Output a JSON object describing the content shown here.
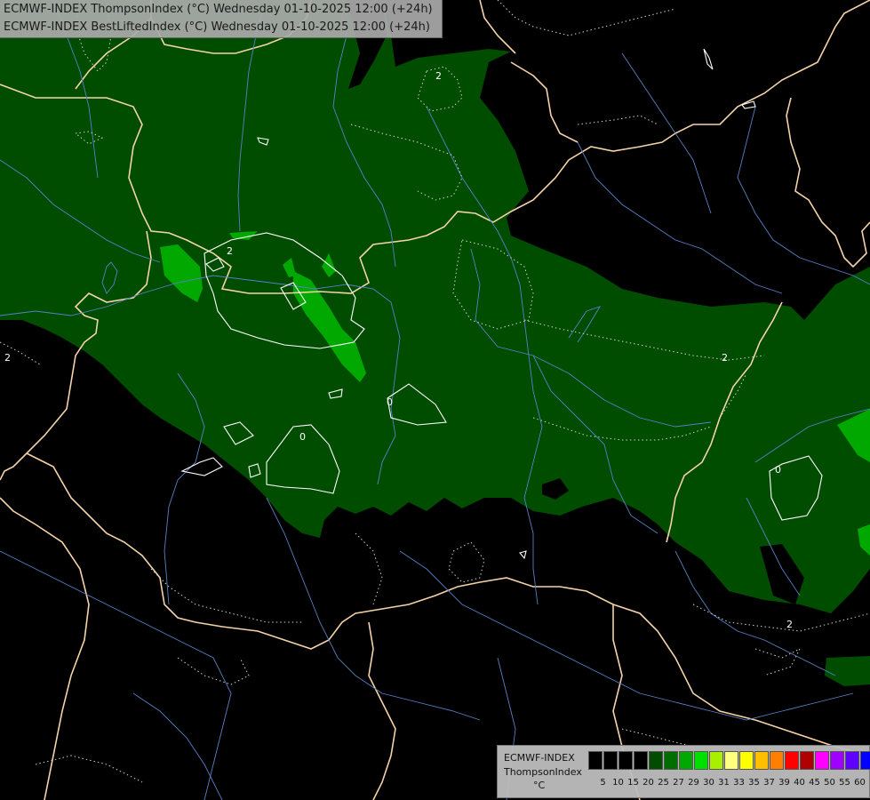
{
  "header": {
    "line1": "ECMWF-INDEX ThompsonIndex (°C) Wednesday 01-10-2025 12:00 (+24h)",
    "line2": "ECMWF-INDEX BestLiftedIndex (°C) Wednesday 01-10-2025 12:00 (+24h)"
  },
  "legend": {
    "model": "ECMWF-INDEX",
    "parameter": "ThompsonIndex",
    "unit": "°C",
    "thresholds": [
      "5",
      "10",
      "15",
      "20",
      "25",
      "27",
      "29",
      "30",
      "31",
      "33",
      "35",
      "37",
      "39",
      "40",
      "45",
      "50",
      "55",
      "60"
    ],
    "colors": [
      "#000000",
      "#000000",
      "#000000",
      "#000000",
      "#004d00",
      "#006d00",
      "#00a800",
      "#00e000",
      "#a8f000",
      "#ffff80",
      "#ffff00",
      "#ffbf00",
      "#ff7f00",
      "#ff0000",
      "#b00000",
      "#ff00ff",
      "#a000ff",
      "#6000ff",
      "#0000ff"
    ]
  },
  "contour_labels": [
    "2",
    "2",
    "2",
    "2",
    "0",
    "0",
    "0",
    "2"
  ],
  "colors": {
    "background": "#000000",
    "field_dark_green": "#004d00",
    "field_bright_green": "#00a800",
    "borders": "#f5d3a8",
    "rivers": "#5a7fc4",
    "contours": "#ffffff"
  }
}
